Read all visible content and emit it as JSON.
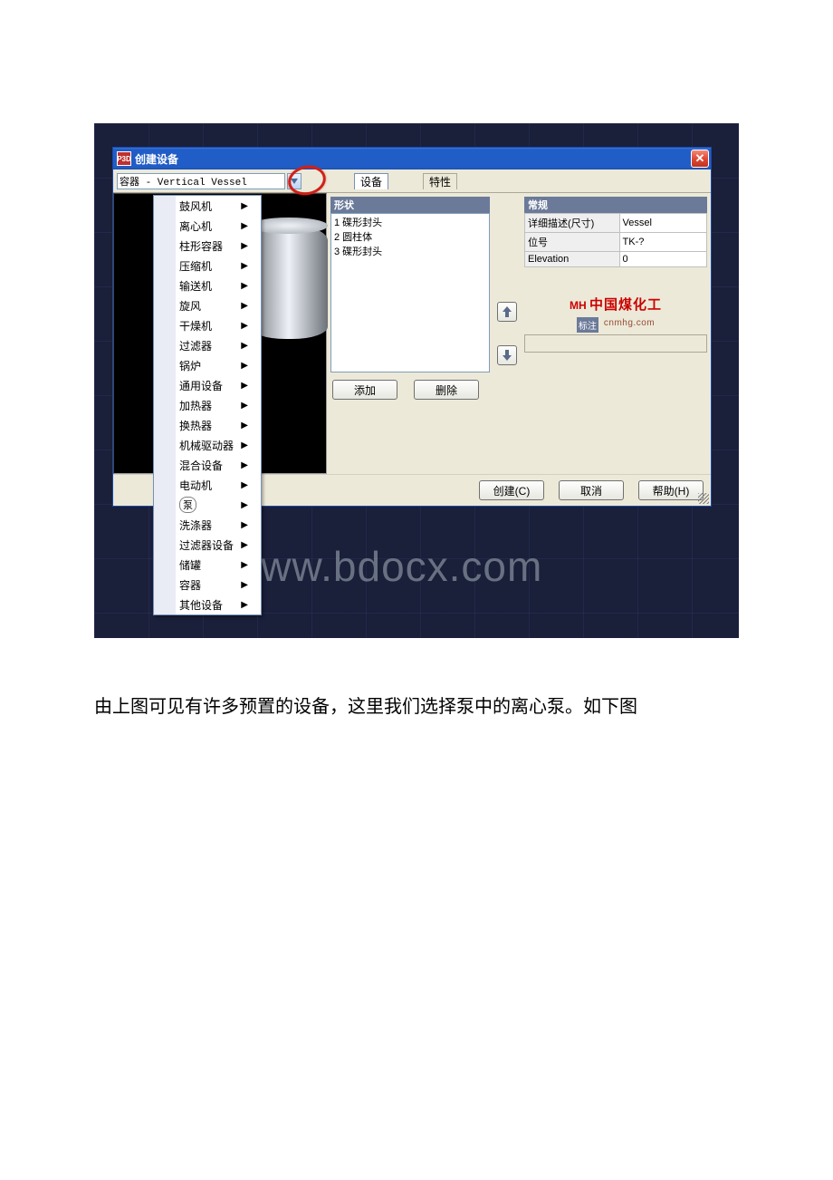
{
  "window": {
    "title": "创建设备",
    "combo_value": "容器 - Vertical Vessel",
    "tabs": {
      "equipment": "设备",
      "properties": "特性"
    }
  },
  "menu": {
    "items": [
      "鼓风机",
      "离心机",
      "柱形容器",
      "压缩机",
      "输送机",
      "旋风",
      "干燥机",
      "过滤器",
      "锅炉",
      "通用设备",
      "加热器",
      "换热器",
      "机械驱动器",
      "混合设备",
      "电动机",
      "泵",
      "洗涤器",
      "过滤器设备",
      "储罐",
      "容器",
      "其他设备"
    ],
    "pump_index": 15
  },
  "shapes": {
    "header": "形状",
    "items": [
      "1 碟形封头",
      "2 圆柱体",
      "3 碟形封头"
    ]
  },
  "props": {
    "header": "常规",
    "rows": [
      {
        "label": "详细描述(尺寸)",
        "value": "Vessel"
      },
      {
        "label": "位号",
        "value": "TK-?"
      },
      {
        "label": "Elevation",
        "value": "0"
      }
    ]
  },
  "watermark": {
    "brand_cn": "中国煤化工",
    "brand_en": "cnmhg.com",
    "big": "www.bdocx.com",
    "muzhu": "标注"
  },
  "buttons": {
    "add": "添加",
    "delete": "删除",
    "create": "创建(C)",
    "cancel": "取消",
    "help": "帮助(H)"
  },
  "caption": "由上图可见有许多预置的设备，这里我们选择泵中的离心泵。如下图"
}
